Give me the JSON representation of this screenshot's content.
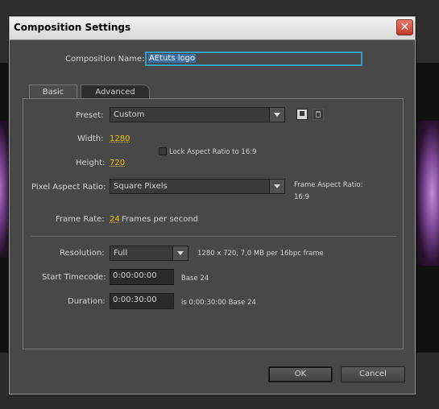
{
  "dialog": {
    "title": "Composition Settings",
    "close_glyph": "✕",
    "composition_name_label": "Composition Name:",
    "composition_name_value": "AEtuts logo"
  },
  "tabs": [
    {
      "label": "Basic"
    },
    {
      "label": "Advanced"
    }
  ],
  "basic": {
    "preset_label": "Preset:",
    "preset_value": "Custom",
    "width_label": "Width:",
    "width_value": "1280",
    "height_label": "Height:",
    "height_value": "720",
    "lock_aspect_label": "Lock Aspect Ratio to 16:9",
    "pixel_aspect_label": "Pixel Aspect Ratio:",
    "pixel_aspect_value": "Square Pixels",
    "frame_aspect_label": "Frame Aspect Ratio:",
    "frame_aspect_value": "16:9",
    "frame_rate_label": "Frame Rate:",
    "frame_rate_value": "24",
    "frame_rate_suffix": "Frames per second",
    "resolution_label": "Resolution:",
    "resolution_value": "Full",
    "resolution_info": "1280 x 720, 7,0 MB per 16bpc frame",
    "start_timecode_label": "Start Timecode:",
    "start_timecode_value": "0:00:00:00",
    "start_timecode_base": "Base 24",
    "duration_label": "Duration:",
    "duration_value": "0:00:30:00",
    "duration_info": "is 0:00:30:00  Base 24"
  },
  "buttons": {
    "ok": "OK",
    "cancel": "Cancel"
  },
  "icons": {
    "save_preset": "save-icon",
    "delete_preset": "trash-icon"
  },
  "colors": {
    "accent_field": "#32a0c6",
    "value_yellow": "#f3c400",
    "dialog_bg": "#484848"
  }
}
